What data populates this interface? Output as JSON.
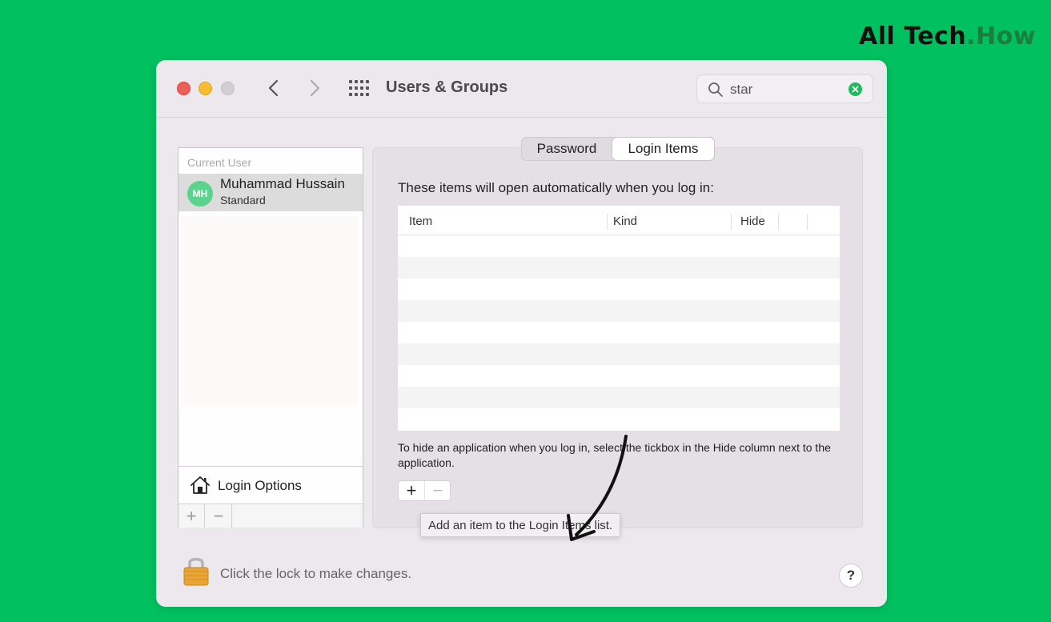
{
  "brand": {
    "main": "All Tech",
    "suffix": ".How"
  },
  "window": {
    "title": "Users & Groups",
    "search": {
      "value": "star"
    }
  },
  "sidebar": {
    "section_label": "Current User",
    "user": {
      "initials": "MH",
      "name": "Muhammad Hussain",
      "role": "Standard"
    },
    "login_options_label": "Login Options",
    "add_label": "+",
    "remove_label": "−"
  },
  "tabs": {
    "password": "Password",
    "login_items": "Login Items",
    "selected": "Login Items"
  },
  "login_items": {
    "intro": "These items will open automatically when you log in:",
    "columns": {
      "item": "Item",
      "kind": "Kind",
      "hide": "Hide"
    },
    "rows": [],
    "hint": "To hide an application when you log in, select the tickbox in the Hide column next to the application.",
    "add_label": "+",
    "remove_label": "−",
    "tooltip": "Add an item to the Login Items list."
  },
  "footer": {
    "lock_text": "Click the lock to make changes.",
    "help_label": "?"
  },
  "colors": {
    "background": "#00c060",
    "accent_green": "#1dbb5d"
  },
  "icons": [
    "back-icon",
    "forward-icon",
    "grid-icon",
    "search-icon",
    "clear-icon",
    "home-icon",
    "lock-icon"
  ]
}
